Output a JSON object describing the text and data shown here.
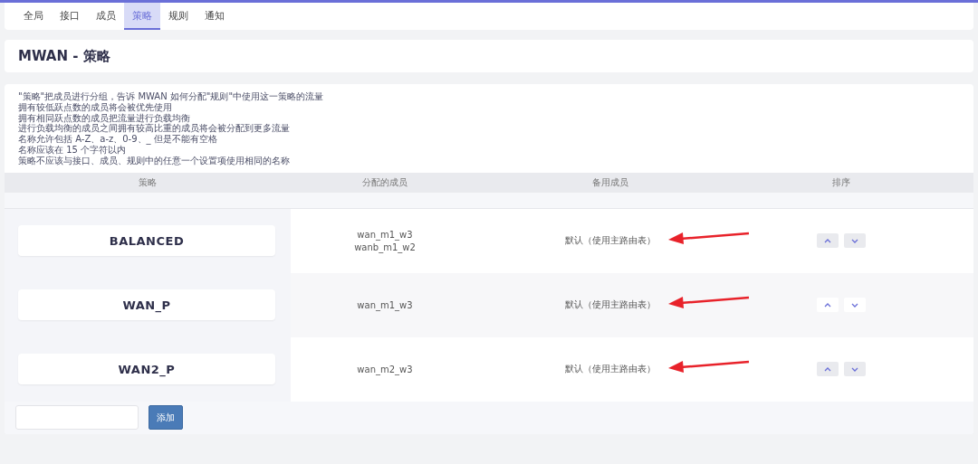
{
  "tabs": [
    {
      "label": "全局",
      "selected": false
    },
    {
      "label": "接口",
      "selected": false
    },
    {
      "label": "成员",
      "selected": false
    },
    {
      "label": "策略",
      "selected": true
    },
    {
      "label": "规则",
      "selected": false
    },
    {
      "label": "通知",
      "selected": false
    }
  ],
  "title": "MWAN - 策略",
  "description": [
    "\"策略\"把成员进行分组，告诉 MWAN 如何分配\"规则\"中使用这一策略的流量",
    "拥有较低跃点数的成员将会被优先使用",
    "拥有相同跃点数的成员把流量进行负载均衡",
    "进行负载均衡的成员之间拥有较高比重的成员将会被分配到更多流量",
    "名称允许包括 A-Z、a-z、0-9、_ 但是不能有空格",
    "名称应该在 15 个字符以内",
    "策略不应该与接口、成员、规则中的任意一个设置项使用相同的名称"
  ],
  "table": {
    "columns": [
      "策略",
      "分配的成员",
      "备用成员",
      "排序"
    ],
    "rows": [
      {
        "name": "BALANCED",
        "members": [
          "wan_m1_w3",
          "wanb_m1_w2"
        ],
        "backup": "默认（使用主路由表）"
      },
      {
        "name": "WAN_P",
        "members": [
          "wan_m1_w3"
        ],
        "backup": "默认（使用主路由表）"
      },
      {
        "name": "WAN2_P",
        "members": [
          "wan_m2_w3"
        ],
        "backup": "默认（使用主路由表）"
      }
    ]
  },
  "add_button": "添加"
}
